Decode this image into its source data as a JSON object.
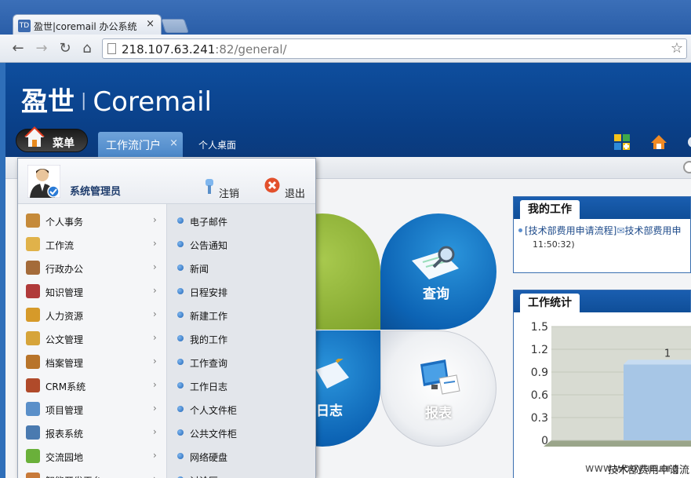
{
  "browser": {
    "tab_favicon": "TD",
    "tab_title": "盈世|coremail 办公系统",
    "tab_close": "×",
    "url_host": "218.107.63.241",
    "url_rest": ":82/general/"
  },
  "header": {
    "logo_cn": "盈世",
    "logo_sep": "|",
    "logo_en": "Coremail",
    "menu_label": "菜单",
    "tabs": [
      {
        "label": "工作流门户",
        "close": "×"
      },
      {
        "label": "个人桌面"
      }
    ]
  },
  "dropdown": {
    "user_name": "系统管理员",
    "logout_label": "注销",
    "quit_label": "退出",
    "left_items": [
      {
        "label": "个人事务",
        "icon": "people-icon"
      },
      {
        "label": "工作流",
        "icon": "workflow-icon"
      },
      {
        "label": "行政办公",
        "icon": "admin-icon"
      },
      {
        "label": "知识管理",
        "icon": "book-icon"
      },
      {
        "label": "人力资源",
        "icon": "hr-folder-icon"
      },
      {
        "label": "公文管理",
        "icon": "document-pen-icon"
      },
      {
        "label": "档案管理",
        "icon": "archive-icon"
      },
      {
        "label": "CRM系统",
        "icon": "crm-icon"
      },
      {
        "label": "项目管理",
        "icon": "project-chart-icon"
      },
      {
        "label": "报表系统",
        "icon": "report-printer-icon"
      },
      {
        "label": "交流园地",
        "icon": "chat-icon"
      },
      {
        "label": "智能开发平台",
        "icon": "dev-platform-icon"
      }
    ],
    "arrow": "›",
    "right_items": [
      "电子邮件",
      "公告通知",
      "新闻",
      "日程安排",
      "新建工作",
      "我的工作",
      "工作查询",
      "工作日志",
      "个人文件柜",
      "公共文件柜",
      "网络硬盘",
      "讨论区"
    ]
  },
  "portal": {
    "query_label": "查询",
    "report_label": "报表",
    "log_label": "日志"
  },
  "my_work": {
    "title": "我的工作",
    "item_text": "[技术部费用申请流程]",
    "item_text2": "技术部费用申",
    "item_time": "11:50:32)"
  },
  "work_stats": {
    "title": "工作统计"
  },
  "chart_data": {
    "type": "bar",
    "categories": [
      "技术部费用申请流程"
    ],
    "values": [
      1
    ],
    "ylim": [
      0,
      1.5
    ],
    "yticks": [
      "1.5",
      "1.2",
      "0.9",
      "0.6",
      "0.3",
      "0"
    ],
    "data_labels": [
      "1"
    ],
    "category_label_visible": "技术部费用申请流"
  },
  "watermark": "www.wooyun.org",
  "colors": {
    "header_blue": "#0e4e9e",
    "tab_blue": "#4b87c8",
    "petal_blue": "#0c63b4",
    "petal_green": "#7ea22a"
  }
}
